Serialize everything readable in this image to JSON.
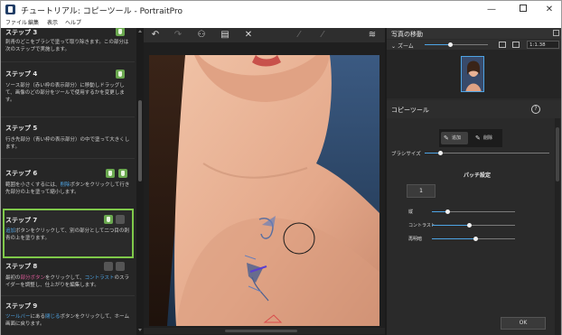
{
  "window": {
    "title": "チュートリアル: コピーツール - PortraitPro",
    "minimize": "—",
    "maximize": "",
    "close": "✕"
  },
  "menu": [
    "ファイル",
    "編集",
    "表示",
    "ヘルプ"
  ],
  "steps": [
    {
      "title": "ステップ 3",
      "body_parts": [
        {
          "t": "刺青のどこをブラシで塗って取り除きます。この部分は次のステップで実施します。",
          "c": ""
        }
      ]
    },
    {
      "title": "ステップ 4",
      "body_parts": [
        {
          "t": "ソース部分（赤い枠の表示部分）に移動しドラッグして、画像のどの部分をツールで使用するかを変更します。",
          "c": ""
        }
      ]
    },
    {
      "title": "ステップ 5",
      "body_parts": [
        {
          "t": "行き先部分（青い枠の表示部分）の中で塗って大きくします。",
          "c": ""
        }
      ]
    },
    {
      "title": "ステップ 6",
      "body_parts": [
        {
          "t": "範囲を小さくするには、",
          "c": ""
        },
        {
          "t": "削除",
          "c": "blue"
        },
        {
          "t": "ボタンをクリックして行き先部分の上を塗って縮小します。",
          "c": ""
        }
      ]
    },
    {
      "title": "ステップ 7",
      "body_parts": [
        {
          "t": "追加",
          "c": "blue"
        },
        {
          "t": "ボタンをクリックして、別の部分として二つ目の刺青の上を塗ります。",
          "c": ""
        }
      ]
    },
    {
      "title": "ステップ 8",
      "body_parts": [
        {
          "t": "最初の",
          "c": ""
        },
        {
          "t": "部分ボタン",
          "c": "pink"
        },
        {
          "t": "をクリックして、",
          "c": ""
        },
        {
          "t": "コントラスト",
          "c": "blue"
        },
        {
          "t": "のスライダーを調整し、仕上がりを編集します。",
          "c": ""
        }
      ]
    },
    {
      "title": "ステップ 9",
      "body_parts": [
        {
          "t": "ツールバー",
          "c": "blue"
        },
        {
          "t": "にある",
          "c": ""
        },
        {
          "t": "閉じる",
          "c": "blue"
        },
        {
          "t": "ボタンをクリックして、ホーム画面に戻ります。",
          "c": ""
        }
      ]
    }
  ],
  "toolbar": {
    "undo": "↶",
    "redo": "↷",
    "person": "⚇",
    "save": "▤",
    "close": "✕",
    "brush1": "⁄",
    "brush2": "⁄",
    "layers": "≋"
  },
  "navigator": {
    "title": "写真の移動",
    "zoom_label": "ズーム",
    "zoom_value": "1:1.38",
    "zoom_level": 0.4
  },
  "copy_tool": {
    "title": "コピーツール",
    "help": "?",
    "add_label": "追加",
    "remove_label": "削除",
    "brush_size_label": "ブラシサイズ",
    "brush_size_level": 0.12,
    "patch_title": "パッチ設定",
    "patch_number": "1",
    "adjustments": [
      {
        "label": "縦",
        "level": 0.18
      },
      {
        "label": "コントラスト",
        "level": 0.45
      },
      {
        "label": "再明暗",
        "level": 0.52
      }
    ],
    "ok_label": "OK"
  },
  "colors": {
    "accent": "#4ea4e4",
    "active_step_border": "#7fc94a",
    "step_button": "#6aa84f",
    "highlight_pink": "#e05b9a"
  }
}
